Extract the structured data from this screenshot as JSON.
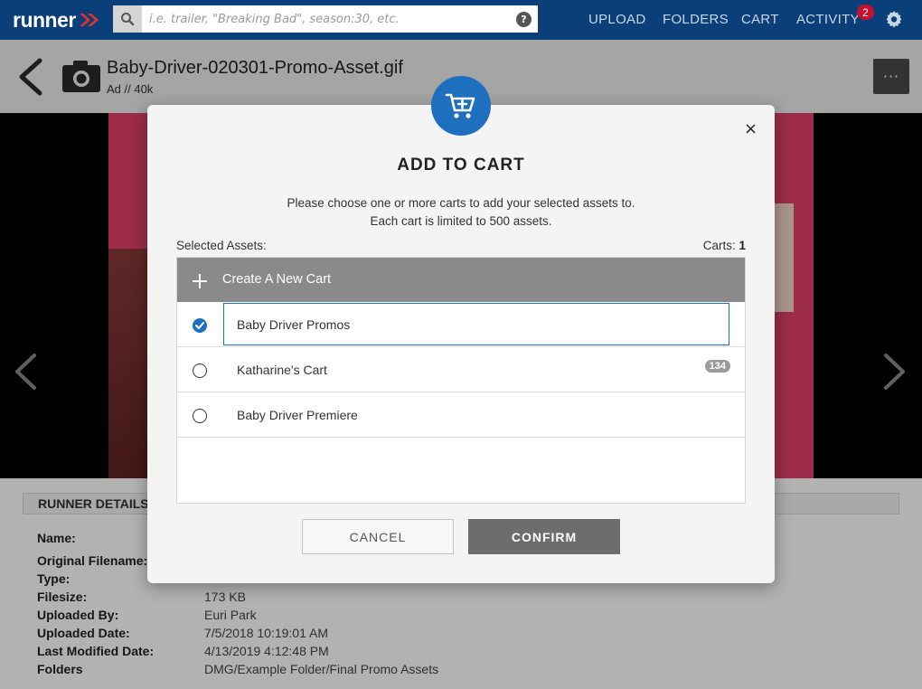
{
  "topnav": {
    "logo": "runner",
    "search_placeholder": "i.e. trailer, \"Breaking Bad\", season:30, etc.",
    "help_label": "?",
    "upload_label": "UPLOAD",
    "folders_label": "FOLDERS",
    "cart_label": "CART",
    "activity_label": "ACTIVITY",
    "activity_badge": "2",
    "brand_color": "#0b3f7a",
    "badge_color": "#c8102e"
  },
  "asset": {
    "title": "Baby-Driver-020301-Promo-Asset.gif",
    "subtitle": "Ad // 40k",
    "more_label": "···"
  },
  "details": {
    "heading": "RUNNER DETAILS",
    "rows": [
      {
        "label": "Name:",
        "value": ""
      },
      {
        "label": "Original Filename:",
        "value": ""
      },
      {
        "label": "Type:",
        "value": ""
      },
      {
        "label": "Filesize:",
        "value": "173 KB"
      },
      {
        "label": "Uploaded By:",
        "value": "Euri Park"
      },
      {
        "label": "Uploaded Date:",
        "value": "7/5/2018 10:19:01 AM"
      },
      {
        "label": "Last Modified Date:",
        "value": "4/13/2019 4:12:48 PM"
      },
      {
        "label": "Folders",
        "value": "DMG/Example Folder/Final Promo Assets"
      }
    ]
  },
  "modal": {
    "title": "ADD TO CART",
    "desc_line1": "Please choose one or more carts to add your selected assets to.",
    "desc_line2": "Each cart is limited to 500 assets.",
    "selected_assets_label": "Selected Assets:",
    "carts_label": "Carts:",
    "carts_count": "1",
    "create_cart_label": "Create A New Cart",
    "carts": [
      {
        "name": "Baby Driver Promos",
        "checked": true,
        "badge": ""
      },
      {
        "name": "Katharine's Cart",
        "checked": false,
        "badge": "134"
      },
      {
        "name": "Baby Driver Premiere",
        "checked": false,
        "badge": ""
      }
    ],
    "cancel_label": "CANCEL",
    "confirm_label": "CONFIRM",
    "close_label": "×",
    "accent_color": "#1f6fbf"
  }
}
